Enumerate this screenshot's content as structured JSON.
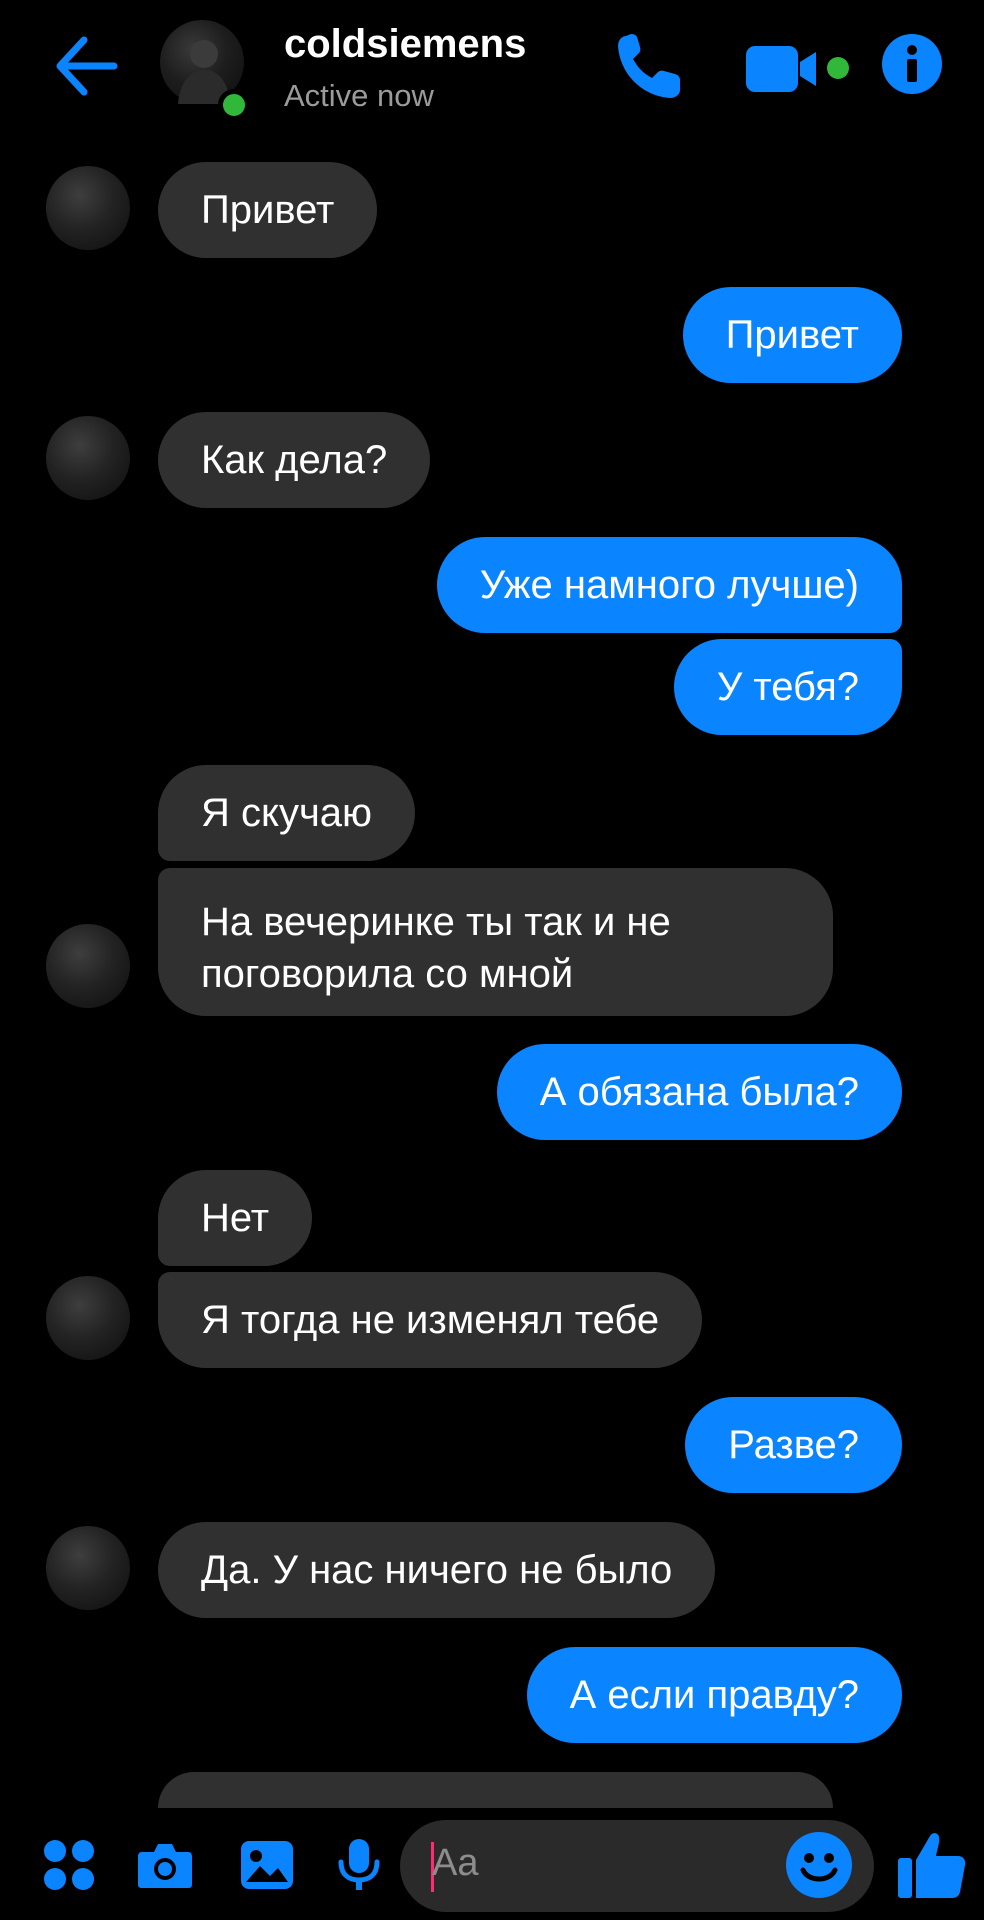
{
  "header": {
    "contact_name": "coldsiemens",
    "status": "Active now",
    "icons": [
      "back-arrow-icon",
      "phone-icon",
      "video-camera-icon",
      "info-icon"
    ]
  },
  "messages": [
    {
      "side": "in",
      "text": "Привет"
    },
    {
      "side": "out",
      "text": "Привет"
    },
    {
      "side": "in",
      "text": "Как дела?"
    },
    {
      "side": "out",
      "text": "Уже намного лучше)"
    },
    {
      "side": "out",
      "text": "У тебя?"
    },
    {
      "side": "in",
      "text": "Я скучаю"
    },
    {
      "side": "in",
      "text": "На вечеринке ты так и не поговорила со мной"
    },
    {
      "side": "out",
      "text": "А обязана была?"
    },
    {
      "side": "in",
      "text": "Нет"
    },
    {
      "side": "in",
      "text": "Я тогда не изменял тебе"
    },
    {
      "side": "out",
      "text": "Разве?"
    },
    {
      "side": "in",
      "text": "Да. У нас ничего не было"
    },
    {
      "side": "out",
      "text": "А если правду?"
    }
  ],
  "composer": {
    "placeholder": "Aa",
    "icons": [
      "menu-dots-icon",
      "camera-icon",
      "gallery-icon",
      "microphone-icon",
      "emoji-icon",
      "thumbs-up-icon"
    ]
  },
  "colors": {
    "accent": "#0a84ff",
    "incoming_bubble": "#303030",
    "online": "#31b83a",
    "background": "#000000"
  }
}
